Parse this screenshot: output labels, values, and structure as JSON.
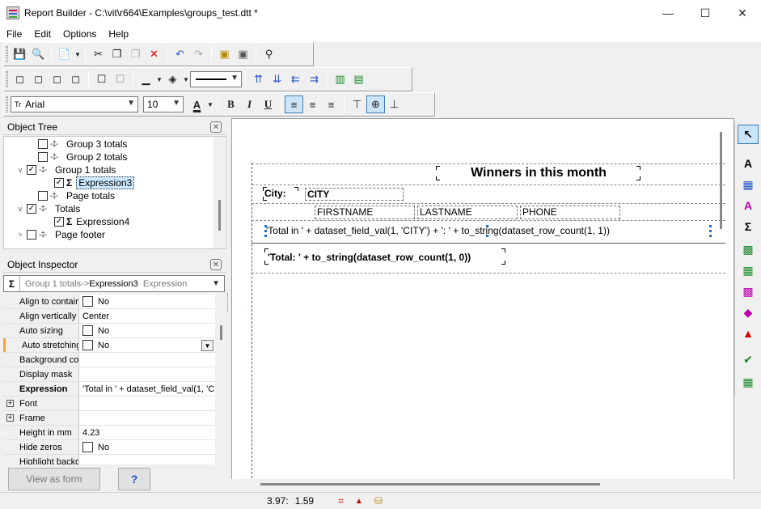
{
  "window": {
    "title": "Report Builder - C:\\vit\\r664\\Examples\\groups_test.dtt *",
    "minimize": "—",
    "maximize": "☐",
    "close": "✕"
  },
  "menu": [
    "File",
    "Edit",
    "Options",
    "Help"
  ],
  "font_toolbar": {
    "font_name": "Arial",
    "font_size": "10",
    "bold": "B",
    "italic": "I",
    "underline": "U"
  },
  "object_tree": {
    "title": "Object Tree",
    "items": [
      {
        "label": "Group 3 totals",
        "checked": false,
        "expand": ""
      },
      {
        "label": "Group 2 totals",
        "checked": false,
        "expand": ""
      },
      {
        "label": "Group 1 totals",
        "checked": true,
        "expand": "v"
      },
      {
        "label": "Expression3",
        "checked": true,
        "expand": ""
      },
      {
        "label": "Page totals",
        "checked": false,
        "expand": ""
      },
      {
        "label": "Totals",
        "checked": true,
        "expand": "v"
      },
      {
        "label": "Expression4",
        "checked": true,
        "expand": ""
      },
      {
        "label": "Page footer",
        "checked": false,
        "expand": ">"
      }
    ]
  },
  "object_inspector": {
    "title": "Object Inspector",
    "selector_path": "Group 1 totals->",
    "selector_object": "Expression3",
    "selector_type": "Expression",
    "properties": [
      {
        "name": "Align to contain",
        "value": "No",
        "checkbox": true
      },
      {
        "name": "Align vertically",
        "value": "Center",
        "checkbox": false
      },
      {
        "name": "Auto sizing",
        "value": "No",
        "checkbox": true
      },
      {
        "name": "Auto stretching",
        "value": "No",
        "checkbox": true
      },
      {
        "name": "Background col",
        "value": "",
        "checkbox": false
      },
      {
        "name": "Display mask",
        "value": "",
        "checkbox": false
      },
      {
        "name": "Expression",
        "value": "'Total in ' + dataset_field_val(1, 'C",
        "checkbox": false
      },
      {
        "name": "Font",
        "value": "",
        "checkbox": false
      },
      {
        "name": "Frame",
        "value": "",
        "checkbox": false
      },
      {
        "name": "Height in mm",
        "value": "4.23",
        "checkbox": false
      },
      {
        "name": "Hide zeros",
        "value": "No",
        "checkbox": true
      },
      {
        "name": "Highlight backg",
        "value": "",
        "checkbox": false
      }
    ],
    "view_as_form": "View as form",
    "help": "?"
  },
  "report": {
    "title": "Winners in this month",
    "city_label": "City:",
    "city_field": "CITY",
    "col_firstname": "FIRSTNAME",
    "col_lastname": "LASTNAME",
    "col_phone": "PHONE",
    "group_total_expr": "'Total in ' + dataset_field_val(1, 'CITY') + ': ' + to_string(dataset_row_count(1, 1))",
    "total_expr": "'Total: ' + to_string(dataset_row_count(1, 0))"
  },
  "status": {
    "coords": "3.97:",
    "coords2": "1.59"
  }
}
